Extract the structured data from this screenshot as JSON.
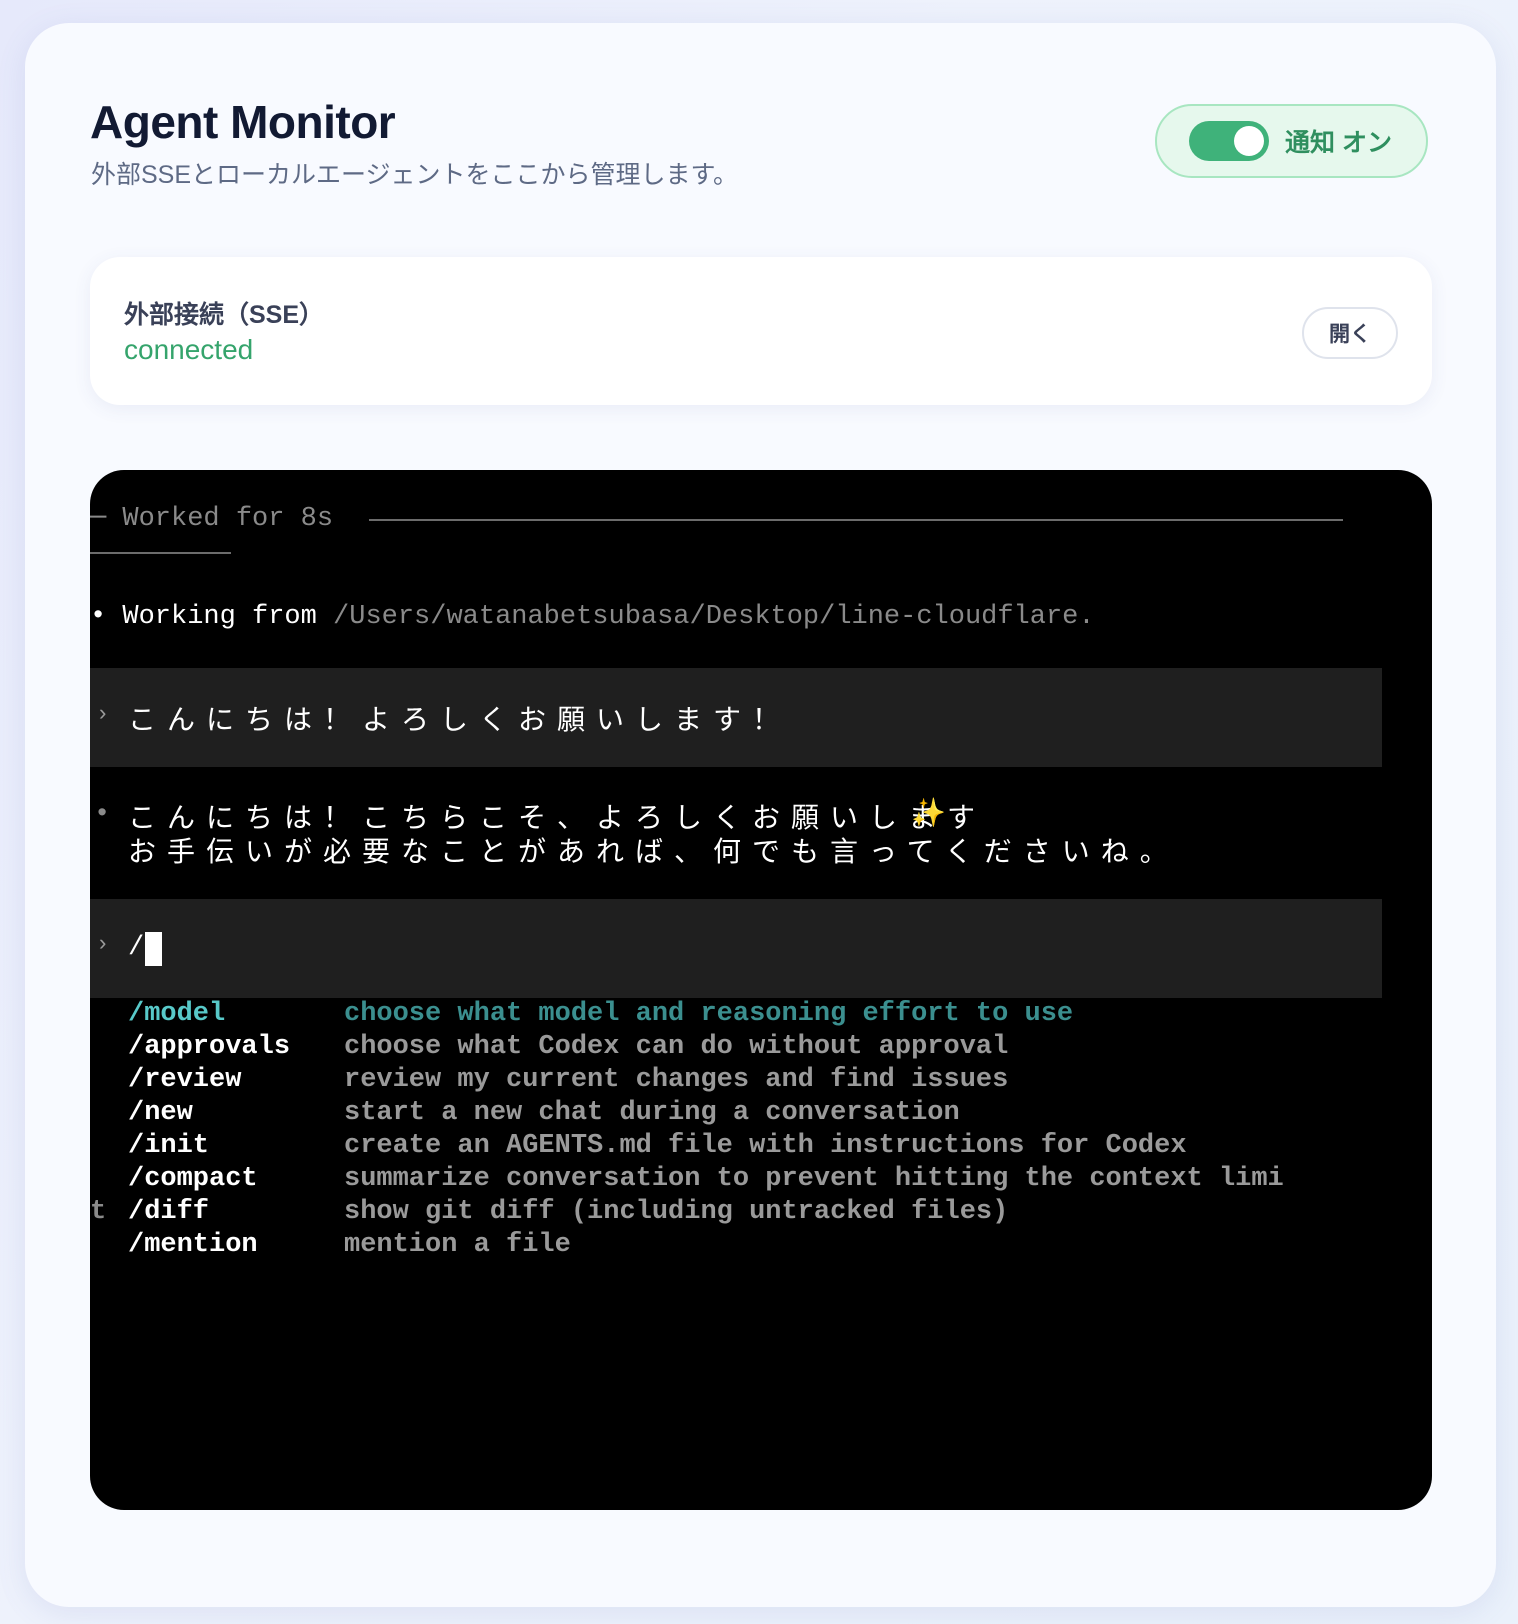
{
  "header": {
    "title": "Agent Monitor",
    "subtitle": "外部SSEとローカルエージェントをここから管理します。"
  },
  "notify_toggle": {
    "label": "通知 オン",
    "state": "on",
    "accent_color": "#3fb27a"
  },
  "sse": {
    "title": "外部接続（SSE）",
    "status": "connected",
    "status_color": "#35a46c",
    "open_label": "開く"
  },
  "terminal": {
    "worked_for": "─ Worked for 8s",
    "working_from_label": "• Working from ",
    "working_from_path": "/Users/watanabetsubasa/Desktop/line-cloudflare.",
    "user_prompt_mark": "›",
    "user_message": "こんにちは！よろしくお願いします！",
    "assistant_bullet": "•",
    "assistant_line1": "こんにちは！こちらこそ、よろしくお願いします",
    "assistant_sparkle": "✨",
    "assistant_line2": "お手伝いが必要なことがあれば、何でも言ってくださいね。",
    "input_prompt_mark": "›",
    "input_value": "/",
    "wrap_overflow_char": "t",
    "commands": [
      {
        "name": "/model",
        "description": "choose what model and reasoning effort to use",
        "selected": true
      },
      {
        "name": "/approvals",
        "description": "choose what Codex can do without approval",
        "selected": false
      },
      {
        "name": "/review",
        "description": "review my current changes and find issues",
        "selected": false
      },
      {
        "name": "/new",
        "description": "start a new chat during a conversation",
        "selected": false
      },
      {
        "name": "/init",
        "description": "create an AGENTS.md file with instructions for Codex",
        "selected": false
      },
      {
        "name": "/compact",
        "description": "summarize conversation to prevent hitting the context limi",
        "selected": false
      },
      {
        "name": "/diff",
        "description": "show git diff (including untracked files)",
        "selected": false
      },
      {
        "name": "/mention",
        "description": "mention a file",
        "selected": false
      }
    ],
    "selected_color": "#58c9c9"
  }
}
